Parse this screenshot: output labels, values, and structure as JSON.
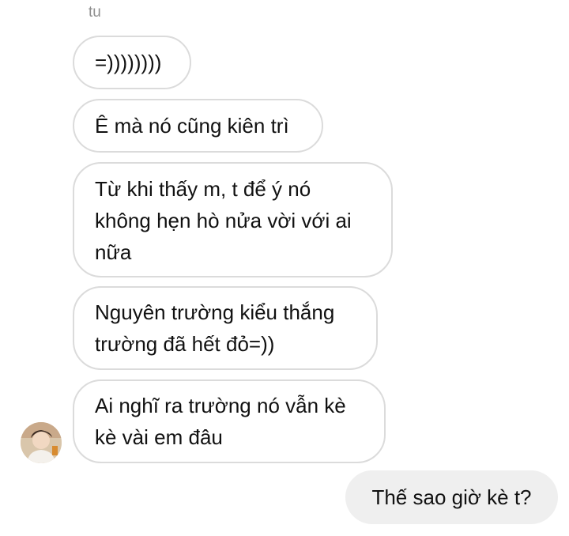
{
  "thread": {
    "sender_name": "tu",
    "incoming_messages": [
      "=))))))))",
      "Ê mà nó cũng kiên trì",
      "Từ khi thấy m, t để ý nó không hẹn hò nửa vời với ai nữa",
      "Nguyên trường kiểu thắng trường đã hết đỏ=))",
      "Ai nghĩ ra trường nó vẫn kè kè vài em đâu"
    ],
    "outgoing_messages": [
      "Thế sao giờ kè t?"
    ]
  },
  "avatar": {
    "icon": "profile-avatar-icon"
  },
  "colors": {
    "background": "#ffffff",
    "incoming_bubble_border": "#dbdbdb",
    "outgoing_bubble_bg": "#efefef",
    "text": "#111111",
    "muted_text": "#8e8e8e"
  }
}
